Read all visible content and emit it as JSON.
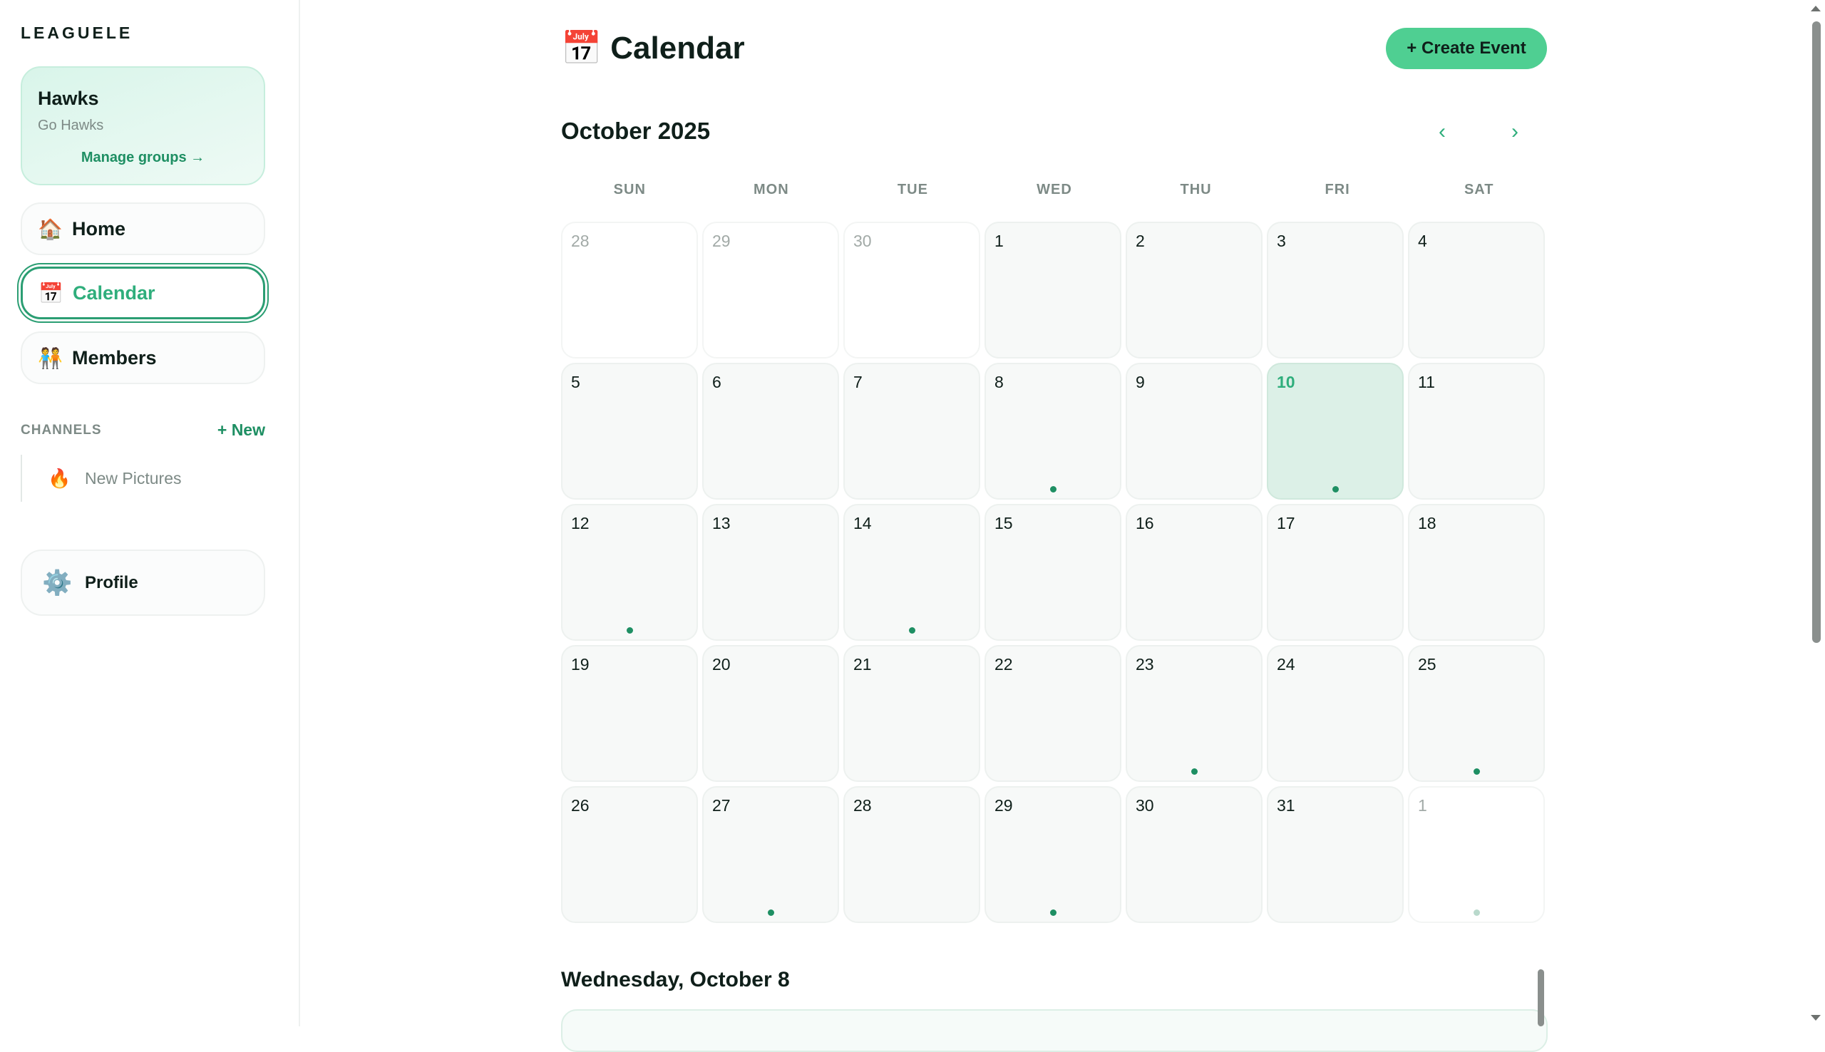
{
  "app": {
    "brand": "LEAGUELE"
  },
  "group": {
    "name": "Hawks",
    "tagline": "Go Hawks",
    "manage_label": "Manage groups →"
  },
  "nav": {
    "home": {
      "icon": "🏠",
      "label": "Home"
    },
    "calendar": {
      "icon": "📅",
      "label": "Calendar",
      "active": true
    },
    "members": {
      "icon": "🧑‍🤝‍🧑",
      "label": "Members"
    }
  },
  "channels": {
    "header": "CHANNELS",
    "new_label": "+ New",
    "items": [
      {
        "icon": "🔥",
        "label": "New Pictures"
      }
    ]
  },
  "profile": {
    "icon": "⚙️",
    "label": "Profile"
  },
  "header": {
    "icon": "📅",
    "title": "Calendar",
    "create_label": "+ Create Event"
  },
  "calendar": {
    "month_label": "October 2025",
    "prev_icon": "‹",
    "next_icon": "›",
    "weekdays": [
      "SUN",
      "MON",
      "TUE",
      "WED",
      "THU",
      "FRI",
      "SAT"
    ],
    "days": [
      {
        "n": "28",
        "other": true
      },
      {
        "n": "29",
        "other": true
      },
      {
        "n": "30",
        "other": true
      },
      {
        "n": "1"
      },
      {
        "n": "2"
      },
      {
        "n": "3"
      },
      {
        "n": "4"
      },
      {
        "n": "5"
      },
      {
        "n": "6"
      },
      {
        "n": "7"
      },
      {
        "n": "8",
        "event": true
      },
      {
        "n": "9"
      },
      {
        "n": "10",
        "today": true,
        "event": true
      },
      {
        "n": "11"
      },
      {
        "n": "12",
        "event": true
      },
      {
        "n": "13"
      },
      {
        "n": "14",
        "event": true
      },
      {
        "n": "15"
      },
      {
        "n": "16"
      },
      {
        "n": "17"
      },
      {
        "n": "18"
      },
      {
        "n": "19"
      },
      {
        "n": "20"
      },
      {
        "n": "21"
      },
      {
        "n": "22"
      },
      {
        "n": "23",
        "event": true
      },
      {
        "n": "24"
      },
      {
        "n": "25",
        "event": true
      },
      {
        "n": "26"
      },
      {
        "n": "27",
        "event": true
      },
      {
        "n": "28"
      },
      {
        "n": "29",
        "event": true
      },
      {
        "n": "30"
      },
      {
        "n": "31"
      },
      {
        "n": "1",
        "other": true,
        "event": true
      }
    ]
  },
  "selected_day": {
    "label": "Wednesday, October 8"
  },
  "colors": {
    "accent": "#2fae7c",
    "button": "#4fcf92",
    "today_bg": "#dcf0e7",
    "event_dot": "#1e8f63"
  }
}
